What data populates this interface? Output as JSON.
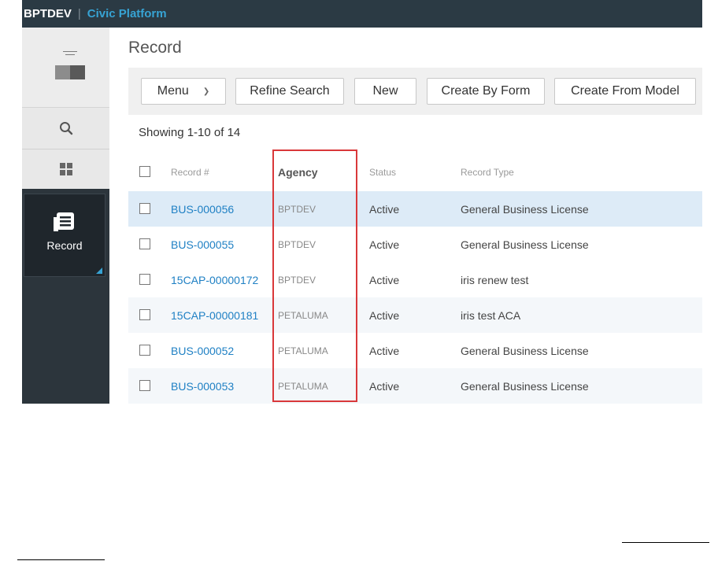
{
  "header": {
    "environment": "BPTDEV",
    "separator": "|",
    "product": "Civic Platform"
  },
  "sidebar": {
    "items": [
      {
        "name": "home",
        "icon": "home-dashboard-icon"
      },
      {
        "name": "search",
        "icon": "search-icon"
      },
      {
        "name": "apps",
        "icon": "apps-grid-icon"
      },
      {
        "name": "record",
        "icon": "record-icon",
        "label": "Record",
        "active": true
      }
    ]
  },
  "page": {
    "title": "Record",
    "showing": "Showing 1-10 of 14"
  },
  "toolbar": {
    "menu": "Menu",
    "refine_search": "Refine Search",
    "new": "New",
    "create_by_form": "Create By Form",
    "create_from_model": "Create From Model"
  },
  "table": {
    "columns": {
      "record_no": "Record #",
      "agency": "Agency",
      "status": "Status",
      "record_type": "Record Type"
    },
    "rows": [
      {
        "record_no": "BUS-000056",
        "agency": "BPTDEV",
        "status": "Active",
        "record_type": "General Business License",
        "selected": true
      },
      {
        "record_no": "BUS-000055",
        "agency": "BPTDEV",
        "status": "Active",
        "record_type": "General Business License"
      },
      {
        "record_no": "15CAP-00000172",
        "agency": "BPTDEV",
        "status": "Active",
        "record_type": "iris renew test"
      },
      {
        "record_no": "15CAP-00000181",
        "agency": "PETALUMA",
        "status": "Active",
        "record_type": "iris test ACA"
      },
      {
        "record_no": "BUS-000052",
        "agency": "PETALUMA",
        "status": "Active",
        "record_type": "General Business License"
      },
      {
        "record_no": "BUS-000053",
        "agency": "PETALUMA",
        "status": "Active",
        "record_type": "General Business License"
      }
    ]
  },
  "colors": {
    "topbar": "#2b3a44",
    "product_accent": "#37a3d4",
    "link": "#1f80c4",
    "selected_row": "#ddebf7",
    "highlight_box": "#d9383a",
    "sidebar_dark": "#2c353c"
  }
}
